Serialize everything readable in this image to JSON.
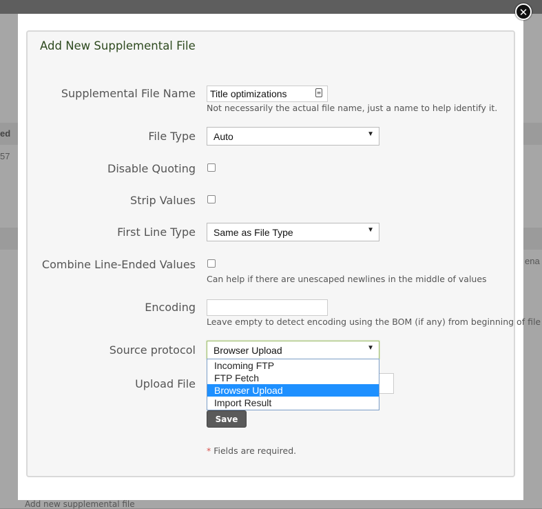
{
  "background": {
    "column_header": "ed",
    "row_value": "57",
    "right_edge_text": "ena",
    "footer_link": "Add new supplemental file"
  },
  "modal": {
    "close_glyph": "✕",
    "title": "Add New Supplemental File",
    "fields": {
      "name": {
        "label": "Supplemental File Name",
        "value": "Title optimizations",
        "help": "Not necessarily the actual file name, just a name to help identify it."
      },
      "file_type": {
        "label": "File Type",
        "value": "Auto"
      },
      "disable_quoting": {
        "label": "Disable Quoting",
        "checked": false
      },
      "strip_values": {
        "label": "Strip Values",
        "checked": false
      },
      "first_line_type": {
        "label": "First Line Type",
        "value": "Same as File Type"
      },
      "combine_line_ended": {
        "label": "Combine Line-Ended Values",
        "checked": false,
        "help": "Can help if there are unescaped newlines in the middle of values"
      },
      "encoding": {
        "label": "Encoding",
        "value": "",
        "help": "Leave empty to detect encoding using the BOM (if any) from beginning of file"
      },
      "source_protocol": {
        "label": "Source protocol",
        "value": "Browser Upload",
        "options": [
          "Incoming FTP",
          "FTP Fetch",
          "Browser Upload",
          "Import Result"
        ],
        "selected_index": 2
      },
      "upload_file": {
        "label": "Upload File"
      }
    },
    "save_label": "Save",
    "required_star": "*",
    "required_note": "Fields are required."
  },
  "colors": {
    "title": "#2e4a1f",
    "selected_option": "#1e90ff",
    "save_button": "#5a5a5a",
    "required_star": "#d9534f"
  }
}
